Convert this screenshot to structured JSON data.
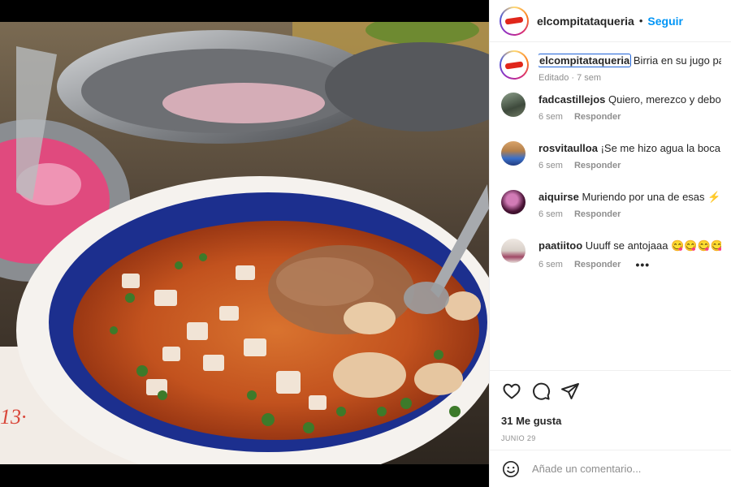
{
  "post": {
    "username": "elcompitataqueria",
    "separator": "•",
    "follow_label": "Seguir"
  },
  "caption": {
    "username": "elcompitataqueria",
    "text": "Birria en su jugo pa la",
    "edited": "Editado",
    "meta_sep": "·",
    "age": "7 sem"
  },
  "comments": [
    {
      "username": "fadcastillejos",
      "text": "Quiero, merezco y debo!! C",
      "age": "6 sem",
      "reply_label": "Responder"
    },
    {
      "username": "rosvitaulloa",
      "text": "¡Se me hizo agua la boca!",
      "age": "6 sem",
      "reply_label": "Responder"
    },
    {
      "username": "aiquirse",
      "text": "Muriendo por una de esas ⚡⚡⚡",
      "age": "6 sem",
      "reply_label": "Responder"
    },
    {
      "username": "paatiitoo",
      "text": "Uuuff se antojaaa 😋😋😋😋😋",
      "age": "6 sem",
      "reply_label": "Responder",
      "more": "•••"
    }
  ],
  "actions": {
    "icons": [
      "heart-icon",
      "comment-icon",
      "share-icon"
    ],
    "likes": "31 Me gusta",
    "date": "JUNIO 29"
  },
  "add_comment": {
    "placeholder": "Añade un comentario..."
  },
  "colors": {
    "accent": "#0095f6",
    "text": "#262626",
    "muted": "#8e8e8e",
    "focus_outline": "#1f63d7"
  }
}
